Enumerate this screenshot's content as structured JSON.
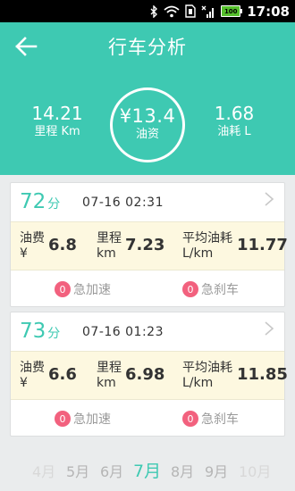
{
  "status_bar": {
    "time": "17:08",
    "battery": "100",
    "icons": [
      "bluetooth-icon",
      "wifi-icon",
      "sim-icon",
      "signal-icon",
      "battery-icon"
    ]
  },
  "header": {
    "title": "行车分析",
    "distance_value": "14.21",
    "distance_label": "里程 Km",
    "cost_value": "¥13.4",
    "cost_label": "油资",
    "consumption_value": "1.68",
    "consumption_label": "油耗 L"
  },
  "trips": [
    {
      "score": "72",
      "score_unit": "分",
      "time": "07-16 02:31",
      "fuel_cost_label_1": "油费",
      "fuel_cost_label_2": "¥",
      "fuel_cost_value": "6.8",
      "distance_label_1": "里程",
      "distance_label_2": "km",
      "distance_value": "7.23",
      "avg_label_1": "平均油耗",
      "avg_label_2": "L/km",
      "avg_value": "11.77",
      "accel_count": "0",
      "accel_label": "急加速",
      "brake_count": "0",
      "brake_label": "急刹车"
    },
    {
      "score": "73",
      "score_unit": "分",
      "time": "07-16 01:23",
      "fuel_cost_label_1": "油费",
      "fuel_cost_label_2": "¥",
      "fuel_cost_value": "6.6",
      "distance_label_1": "里程",
      "distance_label_2": "km",
      "distance_value": "6.98",
      "avg_label_1": "平均油耗",
      "avg_label_2": "L/km",
      "avg_value": "11.85",
      "accel_count": "0",
      "accel_label": "急加速",
      "brake_count": "0",
      "brake_label": "急刹车"
    }
  ],
  "months": [
    "4月",
    "5月",
    "6月",
    "7月",
    "8月",
    "9月",
    "10月"
  ],
  "selected_month": "7月",
  "colors": {
    "accent": "#3ec9b2",
    "badge": "#f2617e",
    "metrics_bg": "#fdf8e0"
  }
}
